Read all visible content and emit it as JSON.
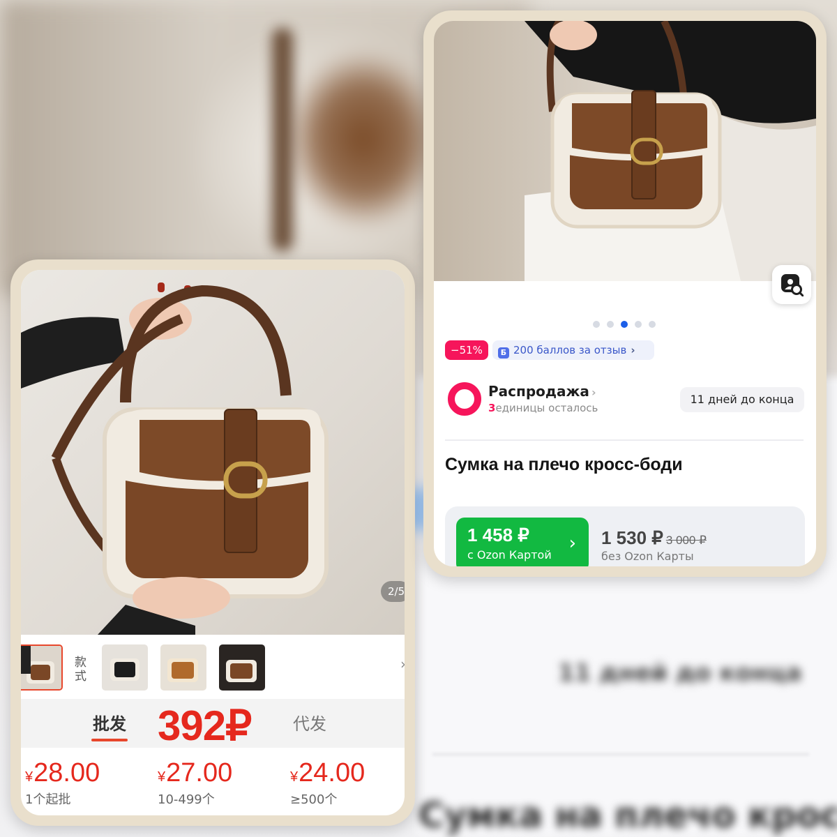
{
  "left_card": {
    "image_counter": "2/5",
    "style_label": "款式",
    "tabs": {
      "wholesale": "批发",
      "dropship": "代发"
    },
    "price_overlay": "392₽",
    "tiers": [
      {
        "currency": "¥",
        "price": "28.00",
        "qty": "1个起批"
      },
      {
        "currency": "¥",
        "price": "27.00",
        "qty": "10-499个"
      },
      {
        "currency": "¥",
        "price": "24.00",
        "qty": "≥500个"
      }
    ],
    "thumbnail_count": 5,
    "selected_thumbnail": 0
  },
  "right_card": {
    "carousel": {
      "total": 5,
      "active": 2
    },
    "discount_badge": "−51%",
    "points_badge": "200 баллов за отзыв",
    "points_icon_letter": "Б",
    "sale": {
      "title": "Распродажа",
      "units_left_num": "3",
      "units_left_text": "единицы осталось",
      "days_left": "11 дней до конца"
    },
    "product_title": "Сумка на плечо кросс-боди",
    "price_card": {
      "price": "1 458 ₽",
      "label": "с Ozon Картой"
    },
    "price_regular": {
      "price": "1 530 ₽",
      "old_price": "3 000 ₽",
      "label": "без Ozon Карты"
    }
  },
  "colors": {
    "accent_red": "#e5281d",
    "ozon_pink": "#f6155b",
    "ozon_green": "#12b941",
    "ozon_blue": "#1d5fe8",
    "card_frame": "#e9dfcc",
    "bag_brown": "#6b3f1f"
  }
}
